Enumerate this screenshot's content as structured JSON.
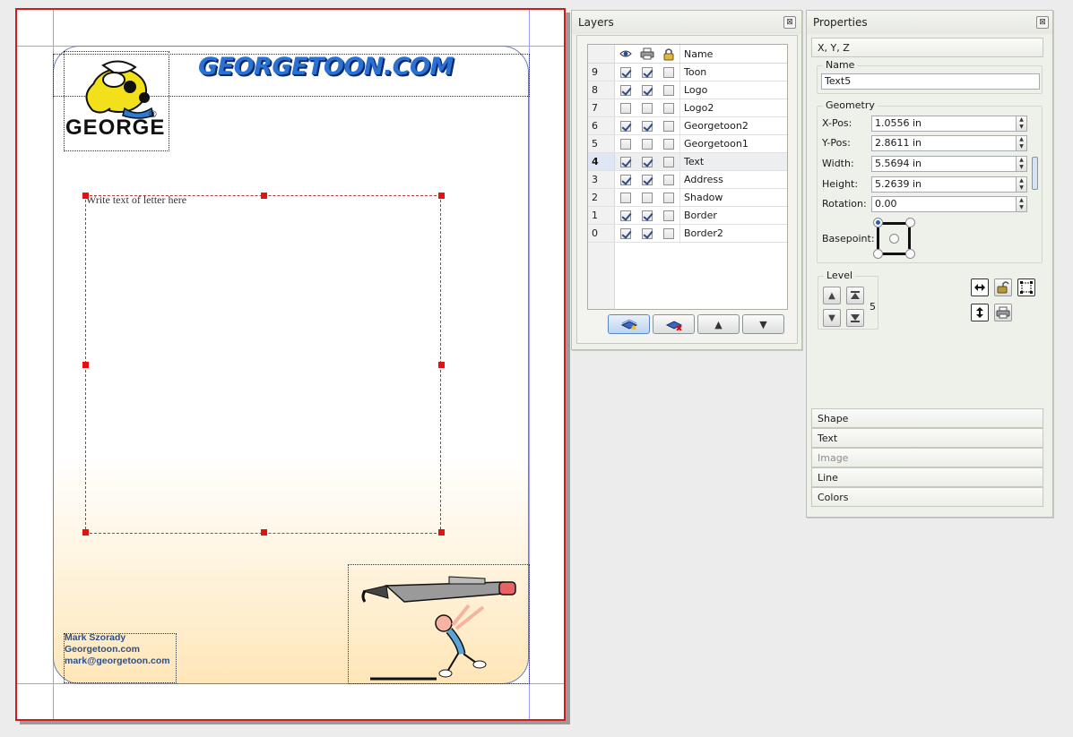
{
  "document": {
    "site_title": "GEORGETOON.COM",
    "logo_text": "GEORGE",
    "logo_mark": "®",
    "text_placeholder": "Write text of letter here",
    "address_lines": [
      "Mark Szorady",
      "Georgetoon.com",
      "mark@georgetoon.com"
    ],
    "colors": {
      "page_border": "#d11b1b",
      "title": "#2b71d4",
      "guides": "#9d9dff"
    }
  },
  "layers_panel": {
    "title": "Layers",
    "close_glyph": "⊠",
    "name_header": "Name",
    "rows": [
      {
        "num": "9",
        "visible": true,
        "printable": true,
        "locked": false,
        "name": "Toon"
      },
      {
        "num": "8",
        "visible": true,
        "printable": true,
        "locked": false,
        "name": "Logo"
      },
      {
        "num": "7",
        "visible": false,
        "printable": false,
        "locked": false,
        "name": "Logo2"
      },
      {
        "num": "6",
        "visible": true,
        "printable": true,
        "locked": false,
        "name": "Georgetoon2"
      },
      {
        "num": "5",
        "visible": false,
        "printable": false,
        "locked": false,
        "name": "Georgetoon1"
      },
      {
        "num": "4",
        "visible": true,
        "printable": true,
        "locked": false,
        "name": "Text",
        "selected": true
      },
      {
        "num": "3",
        "visible": true,
        "printable": true,
        "locked": false,
        "name": "Address"
      },
      {
        "num": "2",
        "visible": false,
        "printable": false,
        "locked": false,
        "name": "Shadow"
      },
      {
        "num": "1",
        "visible": true,
        "printable": true,
        "locked": false,
        "name": "Border"
      },
      {
        "num": "0",
        "visible": true,
        "printable": true,
        "locked": false,
        "name": "Border2"
      }
    ],
    "buttons": [
      {
        "icon": "add-layer-icon",
        "glyph": ""
      },
      {
        "icon": "delete-layer-icon",
        "glyph": ""
      },
      {
        "icon": "raise-layer-icon",
        "glyph": "▲"
      },
      {
        "icon": "lower-layer-icon",
        "glyph": "▼"
      }
    ]
  },
  "properties_panel": {
    "title": "Properties",
    "close_glyph": "⊠",
    "xyz_section": "X, Y, Z",
    "name_group": "Name",
    "name_value": "Text5",
    "geometry_group": "Geometry",
    "fields": [
      {
        "label": "X-Pos:",
        "value": "1.0556 in"
      },
      {
        "label": "Y-Pos:",
        "value": "2.8611 in"
      },
      {
        "label": "Width:",
        "value": "5.5694 in"
      },
      {
        "label": "Height:",
        "value": "5.2639 in"
      },
      {
        "label": "Rotation:",
        "value": "0.00"
      }
    ],
    "basepoint_label": "Basepoint:",
    "level_group": "Level",
    "level_value": "5",
    "spin_up": "▲",
    "spin_down": "▼",
    "sections": [
      "Shape",
      "Text",
      "Image",
      "Line",
      "Colors"
    ]
  }
}
